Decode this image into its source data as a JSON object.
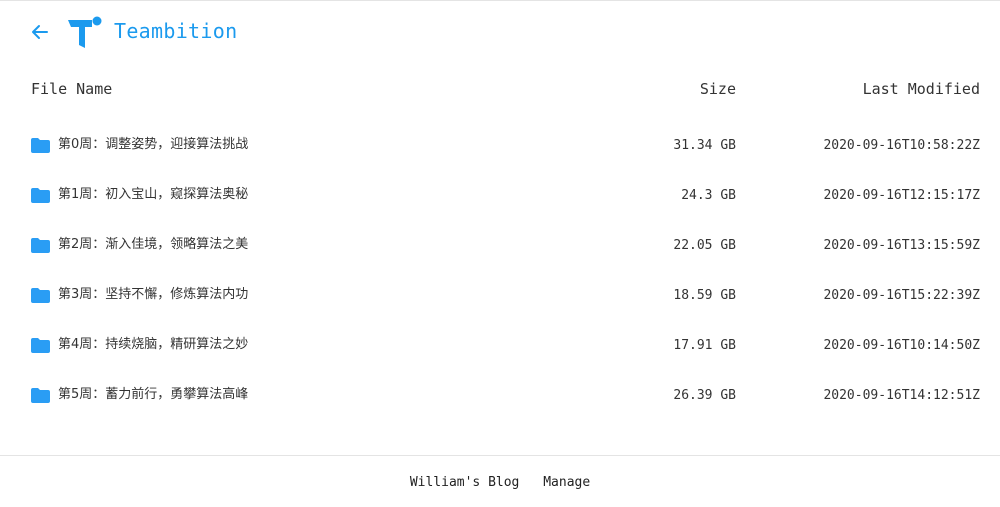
{
  "header": {
    "back_icon": "arrow-left-icon",
    "logo_icon": "teambition-logo-icon",
    "brand": "Teambition",
    "accent_color": "#1b9aee"
  },
  "table": {
    "columns": {
      "name": "File Name",
      "size": "Size",
      "modified": "Last Modified"
    },
    "folder_icon": "folder-icon",
    "folder_color": "#2a9df4",
    "rows": [
      {
        "name": "第0周：调整姿势，迎接算法挑战",
        "size": "31.34 GB",
        "modified": "2020-09-16T10:58:22Z"
      },
      {
        "name": "第1周：初入宝山，窥探算法奥秘",
        "size": "24.3 GB",
        "modified": "2020-09-16T12:15:17Z"
      },
      {
        "name": "第2周：渐入佳境，领略算法之美",
        "size": "22.05 GB",
        "modified": "2020-09-16T13:15:59Z"
      },
      {
        "name": "第3周：坚持不懈，修炼算法内功",
        "size": "18.59 GB",
        "modified": "2020-09-16T15:22:39Z"
      },
      {
        "name": "第4周：持续烧脑，精研算法之妙",
        "size": "17.91 GB",
        "modified": "2020-09-16T10:14:50Z"
      },
      {
        "name": "第5周：蓄力前行，勇攀算法高峰",
        "size": "26.39 GB",
        "modified": "2020-09-16T14:12:51Z"
      }
    ]
  },
  "footer": {
    "blog_link": "William's Blog",
    "manage_link": "Manage"
  }
}
